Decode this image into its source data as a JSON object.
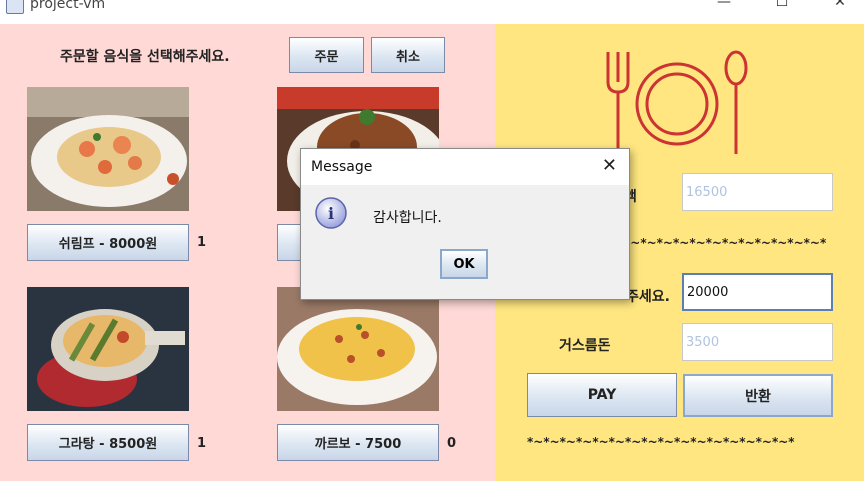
{
  "window": {
    "title": "project-vm",
    "minimize": "—",
    "maximize": "☐",
    "close": "✕"
  },
  "order": {
    "prompt": "주문할 음식을 선택해주세요.",
    "order_button": "주문",
    "cancel_button": "취소"
  },
  "menu": {
    "items": [
      {
        "label": "쉬림프 - 8000원",
        "count": "1"
      },
      {
        "label": "",
        "count": ""
      },
      {
        "label": "그라탕 - 8500원",
        "count": "1"
      },
      {
        "label": "까르보 - 7500",
        "count": "0"
      }
    ]
  },
  "payment": {
    "total_label_partial": "액",
    "total_value": "16500",
    "divider_partial": "*~*~*~*~*~*~*~*~*~*~*~*~*",
    "input_label_partial": "주세요.",
    "input_value": "20000",
    "change_label": "거스름돈",
    "change_value": "3500",
    "pay_button": "PAY",
    "return_button": "반환",
    "divider_bottom": "*~*~*~*~*~*~*~*~*~*~*~*~*~*~*~*~*"
  },
  "dialog": {
    "title": "Message",
    "message": "감사합니다.",
    "ok": "OK",
    "close": "✕",
    "info_glyph": "i"
  },
  "colors": {
    "left_bg": "#ffd9d6",
    "right_bg": "#ffe680",
    "utensil": "#cc3333"
  }
}
